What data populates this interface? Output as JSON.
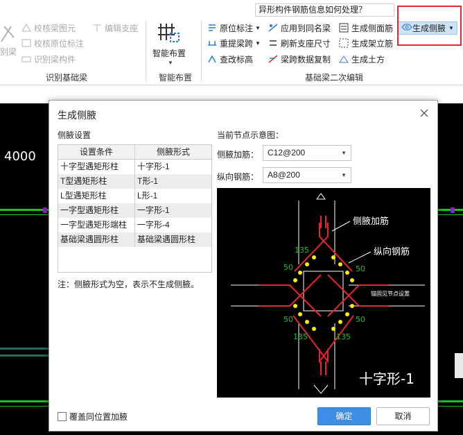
{
  "ribbon": {
    "help_search": "异形构件钢筋信息如何处理？",
    "left_partial": "别梁",
    "identify_group": {
      "check_element": "校核梁图元",
      "edit_support": "编辑支座",
      "check_origin_label": "校核原位标注",
      "identify_member": "识别梁构件",
      "label": "识别基础梁"
    },
    "smart_layout": {
      "button": "智能布置",
      "label": "智能布置"
    },
    "edit_group": {
      "origin_label": "原位标注",
      "apply_same_name": "应用到同名梁",
      "gen_side_rebar": "生成侧面筋",
      "gen_haunch": "生成侧腋",
      "re_extract_span": "重提梁跨",
      "refresh_support_size": "刷新支座尺寸",
      "gen_stirrup": "生成架立筋",
      "check_elevation": "查改标高",
      "copy_span_data": "梁跨数据复制",
      "gen_earthwork": "生成土方",
      "label": "基础梁二次编辑"
    }
  },
  "cad": {
    "dimension_text": "4000"
  },
  "dialog": {
    "title": "生成侧腋",
    "left_title": "侧腋设置",
    "table": {
      "headers": [
        "设置条件",
        "侧腋形式"
      ],
      "rows": [
        [
          "十字型遇矩形柱",
          "十字形-1"
        ],
        [
          "T型遇矩形柱",
          "T形-1"
        ],
        [
          "L型遇矩形柱",
          "L形-1"
        ],
        [
          "一字型遇矩形柱",
          "一字形-1"
        ],
        [
          "一字型遇矩形端柱",
          "一字形-4"
        ],
        [
          "基础梁遇圆形柱",
          "基础梁遇圆形柱"
        ]
      ]
    },
    "note": "注：侧腋形式为空，表示不生成侧腋。",
    "right_title": "当前节点示意图：",
    "haunch_rebar": {
      "label": "侧腋加筋：",
      "value": "C12@200"
    },
    "long_rebar": {
      "label": "纵向钢筋：",
      "value": "A8@200"
    },
    "preview": {
      "label_haunch_rebar": "侧腋加筋",
      "label_long_rebar": "纵向钢筋",
      "dim_135": "135",
      "dim_50": "50",
      "node_ref": "锚固见节点设置",
      "caption": "十字形-1"
    },
    "overwrite_checkbox": "覆盖同位置加腋",
    "ok": "确定",
    "cancel": "取消"
  },
  "colors": {
    "accent": "#3e8ee5",
    "highlight_border": "#e8262b",
    "cad_bg": "#000000",
    "cad_green": "#1ec21e",
    "rebar_red": "#e8262b",
    "dot_yellow": "#ffee00"
  }
}
